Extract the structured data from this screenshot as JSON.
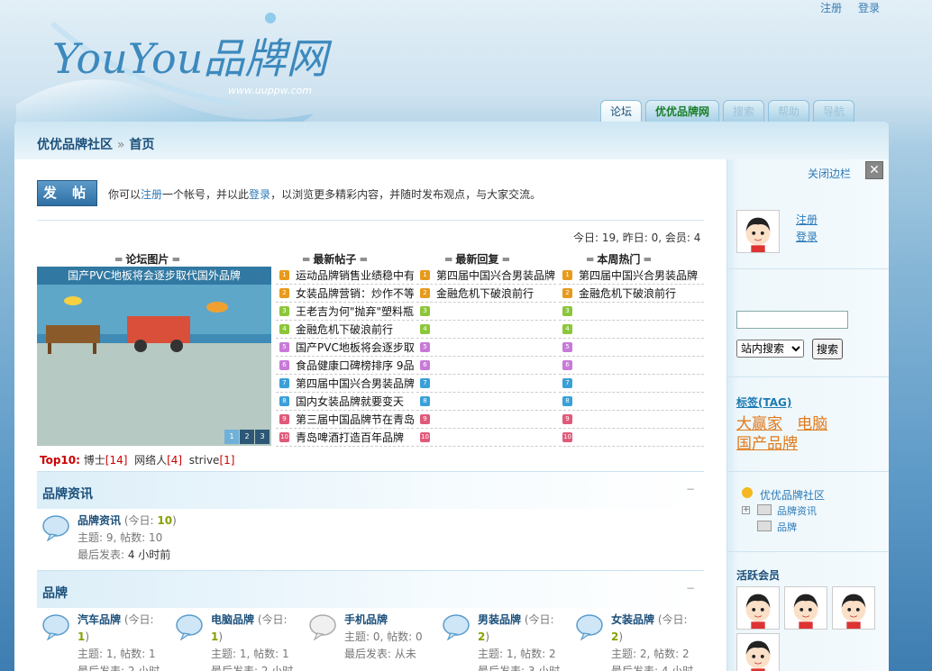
{
  "header": {
    "logo_text": "YouYou品牌网",
    "logo_url": "www.uuppw.com",
    "links": [
      "注册",
      "登录"
    ]
  },
  "tabs": [
    "论坛",
    "优优品牌网",
    "搜索",
    "帮助",
    "导航"
  ],
  "breadcrumb": {
    "root": "优优品牌社区",
    "sep": "»",
    "current": "首页"
  },
  "sidebar_toggle": {
    "label": "关闭边栏",
    "close": "✕"
  },
  "post_button": "发 帖",
  "intro": {
    "pre": "你可以",
    "register": "注册",
    "mid": "一个帐号，并以此",
    "login": "登录",
    "post": "，以浏览更多精彩内容，并随时发布观点，与大家交流。"
  },
  "stats": "今日: 19, 昨日: 0, 会员: 4",
  "columns": {
    "pics": "═ 论坛图片 ═",
    "new_posts": "═ 最新帖子 ═",
    "new_replies": "═ 最新回复 ═",
    "hot": "═ 本周热门 ═"
  },
  "slide": {
    "title": "国产PVC地板将会逐步取代国外品牌",
    "pages": [
      "1",
      "2",
      "3"
    ]
  },
  "new_posts": [
    "运动品牌销售业绩稳中有",
    "女装品牌营销：炒作不等",
    "王老吉为何\"抛弃\"塑料瓶",
    "金融危机下破浪前行",
    "国产PVC地板将会逐步取",
    "食品健康口碑榜排序 9品",
    "第四届中国兴合男装品牌",
    "国内女装品牌就要变天",
    "第三届中国品牌节在青岛",
    "青岛啤酒打造百年品牌"
  ],
  "new_replies": [
    "第四届中国兴合男装品牌",
    "金融危机下破浪前行",
    "",
    "",
    "",
    "",
    "",
    "",
    "",
    ""
  ],
  "hot": [
    "第四届中国兴合男装品牌",
    "金融危机下破浪前行",
    "",
    "",
    "",
    "",
    "",
    "",
    "",
    ""
  ],
  "rank_colors": [
    "#e89a1c",
    "#e89a1c",
    "#8cc63a",
    "#8cc63a",
    "#c77ad8",
    "#c77ad8",
    "#3aa0d8",
    "#3aa0d8",
    "#e05a7a",
    "#e05a7a"
  ],
  "top10": {
    "label": "Top10:",
    "users": [
      {
        "name": "博士",
        "count": "[14]"
      },
      {
        "name": "网络人",
        "count": "[4]"
      },
      {
        "name": "strive",
        "count": "[1]"
      }
    ]
  },
  "section1": {
    "title": "品牌资讯",
    "collapse": "−",
    "forum": {
      "name": "品牌资讯",
      "today_pre": "(今日: ",
      "today": "10",
      "today_post": ")",
      "stats": "主题: 9, 帖数: 10",
      "last_label": "最后发表: ",
      "last": "4 小时前"
    }
  },
  "section2": {
    "title": "品牌",
    "collapse": "−",
    "forums": [
      {
        "name": "汽车品牌",
        "today_pre": "(今日:",
        "today": "1",
        "stats": "主题: 1, 帖数: 1",
        "last": "最后发表: 2 小时"
      },
      {
        "name": "电脑品牌",
        "today_pre": "(今日:",
        "today": "1",
        "stats": "主题: 1, 帖数: 1",
        "last": "最后发表: 2 小时"
      },
      {
        "name": "手机品牌",
        "today_pre": "",
        "today": "",
        "stats": "主题: 0, 帖数: 0",
        "last": "最后发表: 从未"
      },
      {
        "name": "男装品牌",
        "today_pre": "(今日:",
        "today": "2",
        "stats": "主题: 1, 帖数: 2",
        "last": "最后发表: 3 小时"
      },
      {
        "name": "女装品牌",
        "today_pre": "(今日:",
        "today": "2",
        "stats": "主题: 2, 帖数: 2",
        "last": "最后发表: 4 小时"
      }
    ]
  },
  "side": {
    "register": "注册",
    "login": "登录",
    "search_btn": "搜索",
    "search_scope": "站内搜索",
    "tag_title": "标签(TAG)",
    "tags": [
      "大赢家",
      "电脑",
      "国产品牌"
    ],
    "tree": [
      "优优品牌社区",
      "品牌资讯",
      "品牌"
    ],
    "active_title": "活跃会员"
  }
}
